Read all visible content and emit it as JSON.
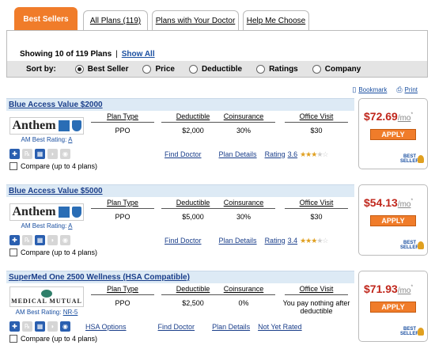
{
  "tabs": [
    {
      "label": "Best Sellers",
      "active": true
    },
    {
      "label": "All Plans (119)",
      "active": false
    },
    {
      "label": "Plans with Your Doctor",
      "active": false
    },
    {
      "label": "Help Me Choose",
      "active": false
    }
  ],
  "results": {
    "showing": "Showing 10 of 119 Plans",
    "sep": "|",
    "show_all": "Show All"
  },
  "sort": {
    "label": "Sort by:",
    "options": [
      {
        "label": "Best Seller",
        "selected": true
      },
      {
        "label": "Price",
        "selected": false
      },
      {
        "label": "Deductible",
        "selected": false
      },
      {
        "label": "Ratings",
        "selected": false
      },
      {
        "label": "Company",
        "selected": false
      }
    ]
  },
  "tools": {
    "bookmark": "Bookmark",
    "print": "Print"
  },
  "columns": {
    "plan_type": "Plan Type",
    "deductible": "Deductible",
    "coinsurance": "Coinsurance",
    "office_visit": "Office Visit"
  },
  "labels": {
    "find_doctor": "Find Doctor",
    "plan_details": "Plan Details",
    "rating": "Rating",
    "compare": "Compare (up to 4 plans)",
    "apply": "APPLY",
    "best_seller": "BEST SELLER",
    "hsa_options": "HSA Options",
    "mo": "/mo",
    "asterisk": "*"
  },
  "plans": [
    {
      "name": "Blue Access Value $2000",
      "logo_text": "Anthem",
      "am_rating_label": "AM Best Rating:",
      "am_rating": "A",
      "plan_type": "PPO",
      "deductible": "$2,000",
      "coinsurance": "30%",
      "office_visit": "$30",
      "rating": "3.6",
      "stars": 3.5,
      "price": "$72.69",
      "price_color": "#c0271c"
    },
    {
      "name": "Blue Access Value $5000",
      "logo_text": "Anthem",
      "am_rating_label": "AM Best Rating:",
      "am_rating": "A",
      "plan_type": "PPO",
      "deductible": "$5,000",
      "coinsurance": "30%",
      "office_visit": "$30",
      "rating": "3.4",
      "stars": 3.5,
      "price": "$54.13",
      "price_color": "#c0271c"
    },
    {
      "name": "SuperMed One 2500 Wellness (HSA Compatible)",
      "logo_text": "MEDICAL MUTUAL",
      "am_rating_label": "AM Best Rating:",
      "am_rating": "NR-5",
      "plan_type": "PPO",
      "deductible": "$2,500",
      "coinsurance": "0%",
      "office_visit": "You pay nothing after deductible",
      "rating_text": "Not Yet Rated",
      "price": "$71.93",
      "price_color": "#c0271c"
    }
  ],
  "colors": {
    "accent": "#f07c2a",
    "link": "#1a3e8a",
    "price": "#c0271c",
    "header_bg": "#ddeaf5"
  }
}
